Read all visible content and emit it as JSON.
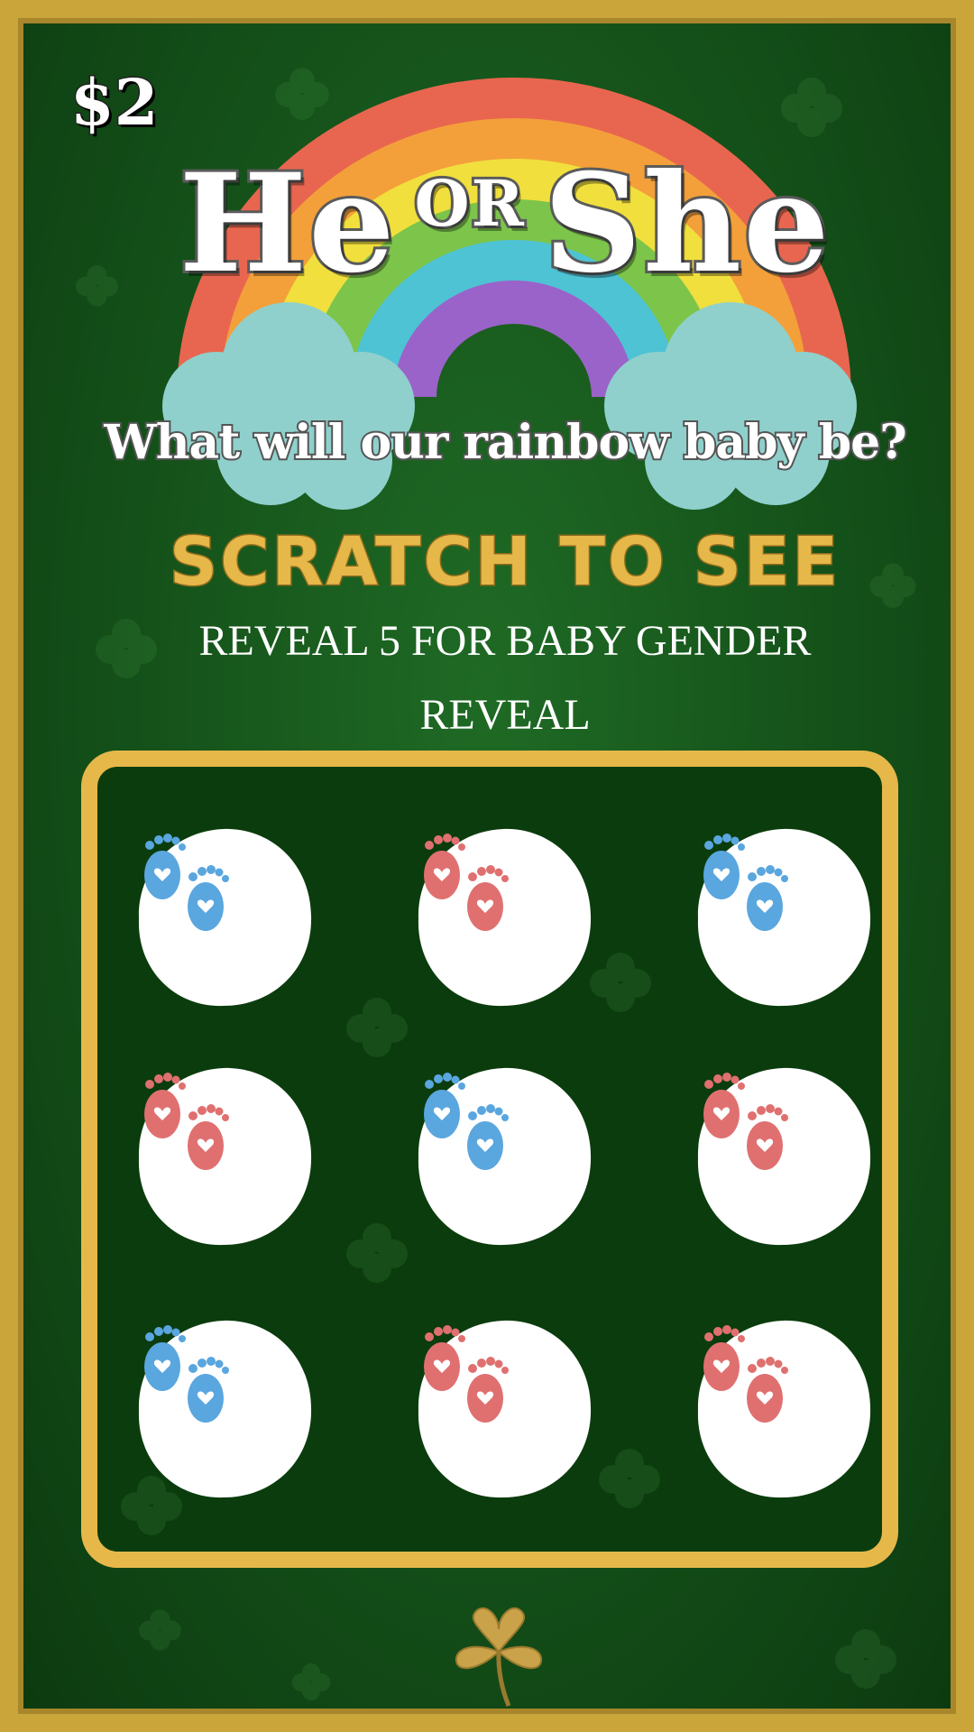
{
  "ticket": {
    "price": "$2",
    "title_left": "He",
    "title_mid": "OR",
    "title_right": "She",
    "subtitle": "What will our rainbow baby be?",
    "scratch_label": "SCRATCH TO SEE",
    "instruction": "REVEAL 5 FOR BABY GENDER REVEAL"
  },
  "colors": {
    "background_green": "#145019",
    "gold": "#e6b84a",
    "blue_feet": "#5aa6df",
    "pink_feet": "#e07070"
  },
  "grid": {
    "tiles": [
      {
        "color": "blue",
        "icon": "baby-feet-icon"
      },
      {
        "color": "pink",
        "icon": "baby-feet-icon"
      },
      {
        "color": "blue",
        "icon": "baby-feet-icon"
      },
      {
        "color": "pink",
        "icon": "baby-feet-icon"
      },
      {
        "color": "blue",
        "icon": "baby-feet-icon"
      },
      {
        "color": "pink",
        "icon": "baby-feet-icon"
      },
      {
        "color": "blue",
        "icon": "baby-feet-icon"
      },
      {
        "color": "pink",
        "icon": "baby-feet-icon"
      },
      {
        "color": "pink",
        "icon": "baby-feet-icon"
      }
    ]
  }
}
